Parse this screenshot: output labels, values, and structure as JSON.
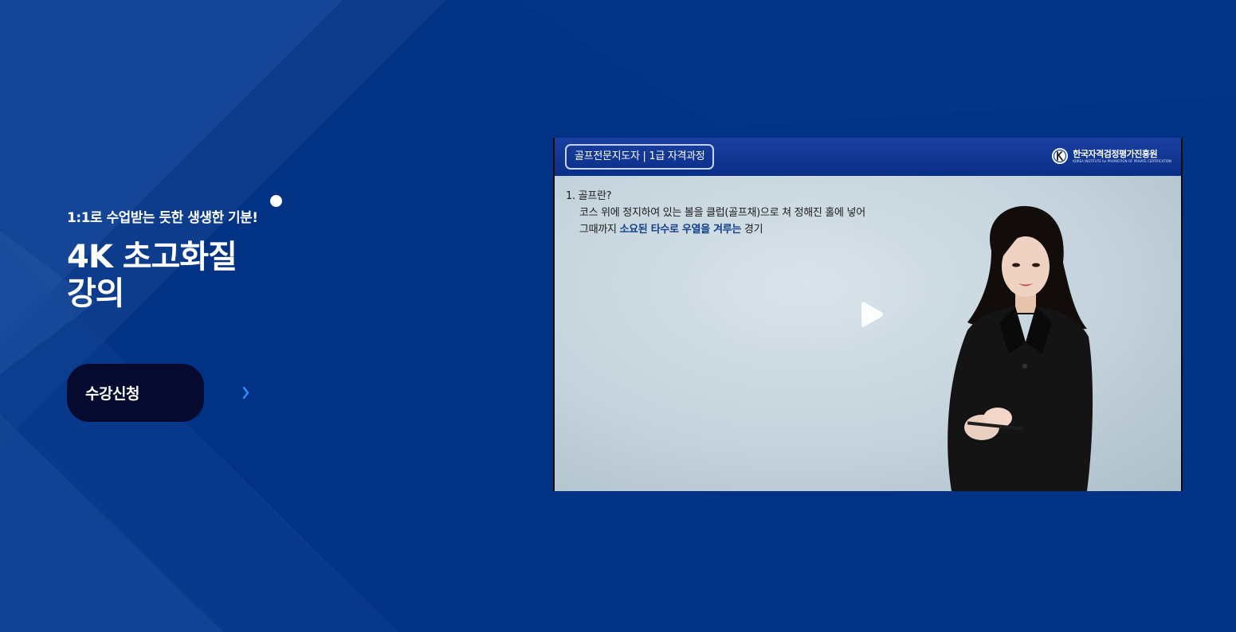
{
  "hero": {
    "subtitle": "1:1로 수업받는 듯한 생생한 기분!",
    "title_line1": "4K 초고화질",
    "title_line2": "강의",
    "cta_label": "수강신청"
  },
  "video": {
    "course_badge": "골프전문지도자 | 1급 자격과정",
    "org_name": "한국자격검정평가진흥원",
    "org_subtitle": "KOREA INSTITUTE for PROMOTION OF PRIVATE CERTIFICATION",
    "slide": {
      "heading": "1. 골프란?",
      "line1": "코스 위에 정지하여 있는 볼을 클럽(골프채)으로 쳐 정해진 홀에 넣어",
      "line2_prefix": "그때까지 ",
      "line2_highlight": "소요된 타수로 우열을 겨루는",
      "line2_suffix": " 경기"
    }
  },
  "icons": {
    "cta_arrow": "chevron-right-icon",
    "play": "play-icon",
    "org_logo": "k-logo-icon"
  },
  "colors": {
    "background": "#023284",
    "cta_bg": "#050a2e",
    "cta_arrow": "#2f8dff",
    "video_header": "#0d3a9a",
    "slide_highlight": "#123f8a"
  }
}
